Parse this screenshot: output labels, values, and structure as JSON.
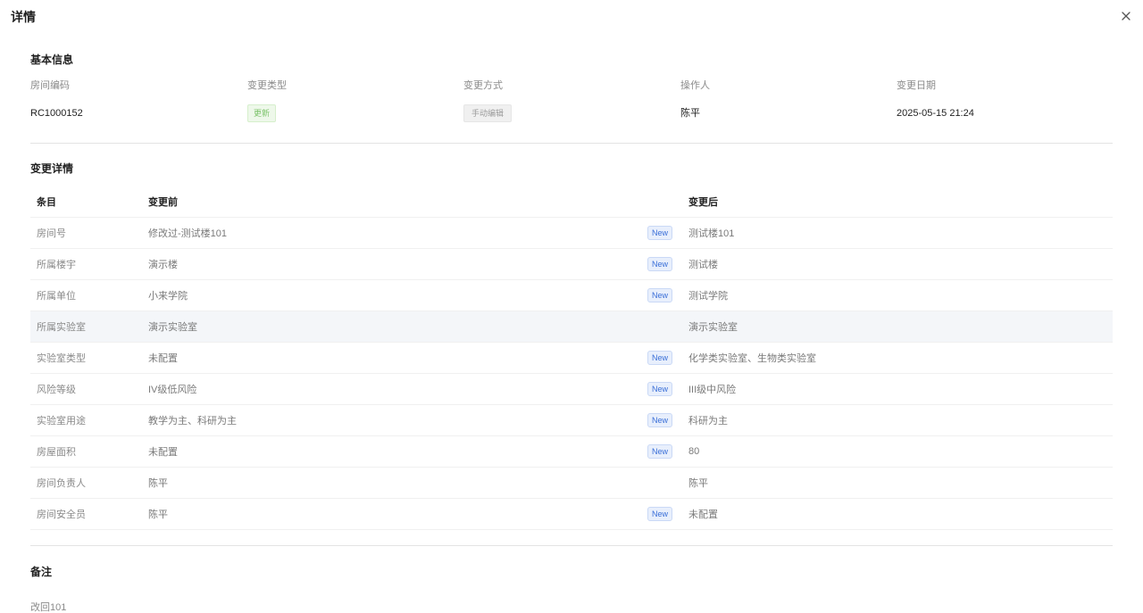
{
  "dialog": {
    "title": "详情"
  },
  "basic_info": {
    "title": "基本信息",
    "fields": [
      {
        "label": "房间编码",
        "value": "RC1000152"
      },
      {
        "label": "变更类型",
        "value": "更新"
      },
      {
        "label": "变更方式",
        "value": "手动编辑"
      },
      {
        "label": "操作人",
        "value": "陈平"
      },
      {
        "label": "变更日期",
        "value": "2025-05-15 21:24"
      }
    ]
  },
  "change_details": {
    "title": "变更详情",
    "columns": {
      "item": "条目",
      "before": "变更前",
      "after": "变更后"
    },
    "badge_label": "New",
    "rows": [
      {
        "item": "房间号",
        "before": "修改过-测试楼101",
        "after": "测试楼101",
        "is_new": true,
        "highlight": false
      },
      {
        "item": "所属楼宇",
        "before": "演示楼",
        "after": "测试楼",
        "is_new": true,
        "highlight": false
      },
      {
        "item": "所属单位",
        "before": "小来学院",
        "after": "测试学院",
        "is_new": true,
        "highlight": false
      },
      {
        "item": "所属实验室",
        "before": "演示实验室",
        "after": "演示实验室",
        "is_new": false,
        "highlight": true
      },
      {
        "item": "实验室类型",
        "before": "未配置",
        "after": "化学类实验室、生物类实验室",
        "is_new": true,
        "highlight": false
      },
      {
        "item": "风险等级",
        "before": "IV级低风险",
        "after": "III级中风险",
        "is_new": true,
        "highlight": false
      },
      {
        "item": "实验室用途",
        "before": "教学为主、科研为主",
        "after": "科研为主",
        "is_new": true,
        "highlight": false
      },
      {
        "item": "房屋面积",
        "before": "未配置",
        "after": "80",
        "is_new": true,
        "highlight": false
      },
      {
        "item": "房间负责人",
        "before": "陈平",
        "after": "陈平",
        "is_new": false,
        "highlight": false
      },
      {
        "item": "房间安全员",
        "before": "陈平",
        "after": "未配置",
        "is_new": true,
        "highlight": false
      }
    ]
  },
  "remarks": {
    "title": "备注",
    "text": "改回101"
  },
  "colors": {
    "tag_green": "#7cc36a",
    "badge_blue": "#3a6fd8",
    "row_highlight": "#f4f6f9"
  }
}
